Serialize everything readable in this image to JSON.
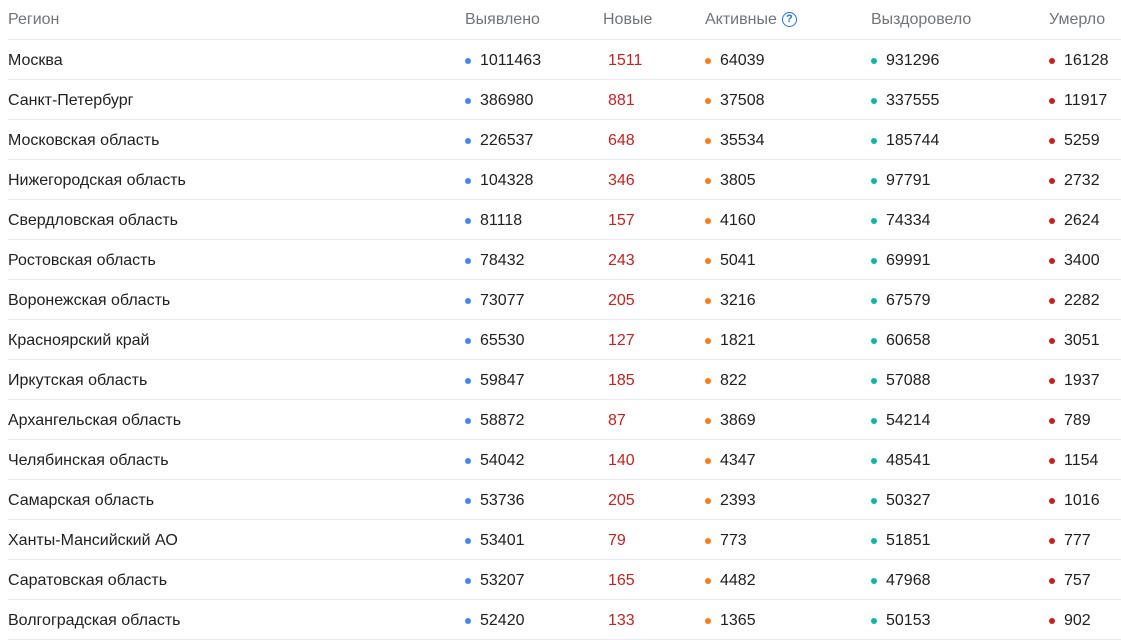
{
  "headers": {
    "region": "Регион",
    "found": "Выявлено",
    "new": "Новые",
    "active": "Активные",
    "recovered": "Выздоровело",
    "deaths": "Умерло",
    "help_glyph": "?"
  },
  "colors": {
    "found_dot": "#4285f4",
    "active_dot": "#fa7b17",
    "recovered_dot": "#12b5a3",
    "deaths_dot": "#c5221f",
    "new_text": "#c5221f"
  },
  "rows": [
    {
      "region": "Москва",
      "found": "1011463",
      "new": "1511",
      "active": "64039",
      "recovered": "931296",
      "deaths": "16128"
    },
    {
      "region": "Санкт-Петербург",
      "found": "386980",
      "new": "881",
      "active": "37508",
      "recovered": "337555",
      "deaths": "11917"
    },
    {
      "region": "Московская область",
      "found": "226537",
      "new": "648",
      "active": "35534",
      "recovered": "185744",
      "deaths": "5259"
    },
    {
      "region": "Нижегородская область",
      "found": "104328",
      "new": "346",
      "active": "3805",
      "recovered": "97791",
      "deaths": "2732"
    },
    {
      "region": "Свердловская область",
      "found": "81118",
      "new": "157",
      "active": "4160",
      "recovered": "74334",
      "deaths": "2624"
    },
    {
      "region": "Ростовская область",
      "found": "78432",
      "new": "243",
      "active": "5041",
      "recovered": "69991",
      "deaths": "3400"
    },
    {
      "region": "Воронежская область",
      "found": "73077",
      "new": "205",
      "active": "3216",
      "recovered": "67579",
      "deaths": "2282"
    },
    {
      "region": "Красноярский край",
      "found": "65530",
      "new": "127",
      "active": "1821",
      "recovered": "60658",
      "deaths": "3051"
    },
    {
      "region": "Иркутская область",
      "found": "59847",
      "new": "185",
      "active": "822",
      "recovered": "57088",
      "deaths": "1937"
    },
    {
      "region": "Архангельская область",
      "found": "58872",
      "new": "87",
      "active": "3869",
      "recovered": "54214",
      "deaths": "789"
    },
    {
      "region": "Челябинская область",
      "found": "54042",
      "new": "140",
      "active": "4347",
      "recovered": "48541",
      "deaths": "1154"
    },
    {
      "region": "Самарская область",
      "found": "53736",
      "new": "205",
      "active": "2393",
      "recovered": "50327",
      "deaths": "1016"
    },
    {
      "region": "Ханты-Мансийский АО",
      "found": "53401",
      "new": "79",
      "active": "773",
      "recovered": "51851",
      "deaths": "777"
    },
    {
      "region": "Саратовская область",
      "found": "53207",
      "new": "165",
      "active": "4482",
      "recovered": "47968",
      "deaths": "757"
    },
    {
      "region": "Волгоградская область",
      "found": "52420",
      "new": "133",
      "active": "1365",
      "recovered": "50153",
      "deaths": "902"
    }
  ]
}
